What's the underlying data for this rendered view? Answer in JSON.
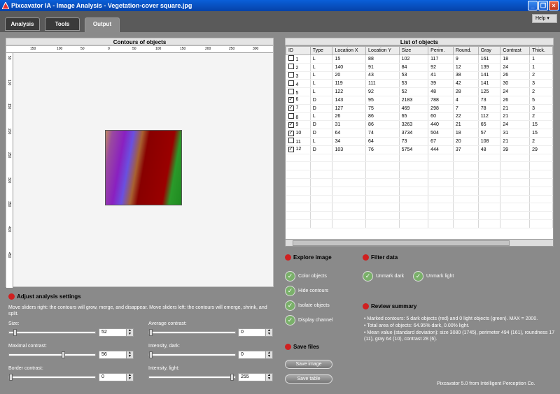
{
  "window": {
    "title": "Pixcavator IA - Image Analysis - Vegetation-cover square.jpg"
  },
  "tabs": [
    {
      "label": "Analysis"
    },
    {
      "label": "Tools"
    },
    {
      "label": "Output"
    }
  ],
  "help_label": "Help",
  "contours": {
    "title": "Contours of objects",
    "top_ticks": [
      "150",
      "100",
      "50",
      "0",
      "50",
      "100",
      "150",
      "200",
      "250",
      "300"
    ],
    "left_ticks": [
      "50",
      "100",
      "150",
      "200",
      "250",
      "300",
      "350",
      "400",
      "450"
    ]
  },
  "list": {
    "title": "List of objects",
    "columns": [
      "ID",
      "Type",
      "Location X",
      "Location Y",
      "Size",
      "Perim.",
      "Round.",
      "Gray",
      "Contrast",
      "Thick."
    ],
    "rows": [
      {
        "checked": false,
        "cells": [
          "1",
          "L",
          "15",
          "88",
          "102",
          "117",
          "9",
          "161",
          "18",
          "1"
        ]
      },
      {
        "checked": false,
        "cells": [
          "2",
          "L",
          "140",
          "91",
          "84",
          "92",
          "12",
          "139",
          "24",
          "1"
        ]
      },
      {
        "checked": false,
        "cells": [
          "3",
          "L",
          "20",
          "43",
          "53",
          "41",
          "38",
          "141",
          "26",
          "2"
        ]
      },
      {
        "checked": false,
        "cells": [
          "4",
          "L",
          "119",
          "111",
          "53",
          "39",
          "42",
          "141",
          "30",
          "3"
        ]
      },
      {
        "checked": false,
        "cells": [
          "5",
          "L",
          "122",
          "92",
          "52",
          "48",
          "28",
          "125",
          "24",
          "2"
        ]
      },
      {
        "checked": true,
        "cells": [
          "6",
          "D",
          "143",
          "95",
          "2183",
          "788",
          "4",
          "73",
          "26",
          "5"
        ]
      },
      {
        "checked": true,
        "cells": [
          "7",
          "D",
          "127",
          "75",
          "469",
          "298",
          "7",
          "78",
          "21",
          "3"
        ]
      },
      {
        "checked": false,
        "cells": [
          "8",
          "L",
          "26",
          "86",
          "65",
          "60",
          "22",
          "112",
          "21",
          "2"
        ]
      },
      {
        "checked": true,
        "cells": [
          "9",
          "D",
          "31",
          "86",
          "3263",
          "440",
          "21",
          "65",
          "24",
          "15"
        ]
      },
      {
        "checked": true,
        "cells": [
          "10",
          "D",
          "64",
          "74",
          "3734",
          "504",
          "18",
          "57",
          "31",
          "15"
        ]
      },
      {
        "checked": false,
        "cells": [
          "11",
          "L",
          "34",
          "64",
          "73",
          "67",
          "20",
          "108",
          "21",
          "2"
        ]
      },
      {
        "checked": true,
        "cells": [
          "12",
          "D",
          "103",
          "76",
          "5754",
          "444",
          "37",
          "48",
          "39",
          "29"
        ]
      }
    ]
  },
  "explore": {
    "title": "Explore image",
    "items": [
      "Color objects",
      "Hide contours",
      "Isolate objects",
      "Display channel"
    ]
  },
  "filter": {
    "title": "Filter data",
    "items": [
      "Unmark dark",
      "Unmark light"
    ]
  },
  "save": {
    "title": "Save files",
    "image_btn": "Save image",
    "table_btn": "Save table"
  },
  "review": {
    "title": "Review summary",
    "lines": [
      "• Marked contours: 5 dark objects (red) and 0 light objects (green). MAX = 2000.",
      "• Total area of objects: 64.95% dark, 0.00% light.",
      "• Mean value (standard deviation): size 3080 (1745), perimeter 494 (161), roundness 17 (11), gray 64 (10), contrast 28 (6)."
    ]
  },
  "settings": {
    "title": "Adjust analysis settings",
    "description": "Move sliders right: the contours will grow, merge, and disappear. Move sliders left: the contours will emerge, shrink, and split.",
    "size_label": "Size:",
    "size_value": "52",
    "size_level": 0.05,
    "maxcontrast_label": "Maximal contrast:",
    "maxcontrast_value": "56",
    "maxcontrast_level": 0.65,
    "border_label": "Border contrast:",
    "border_value": "0",
    "border_level": 0.0,
    "avgcontrast_label": "Average contrast:",
    "avgcontrast_value": "0",
    "avgcontrast_level": 0.0,
    "intdark_label": "Intensity, dark:",
    "intdark_value": "0",
    "intdark_level": 0.0,
    "intlight_label": "Intensity, light:",
    "intlight_value": "255",
    "intlight_level": 1.0
  },
  "footer": "Pixcavator 5.0 from Intelligent Perception Co."
}
